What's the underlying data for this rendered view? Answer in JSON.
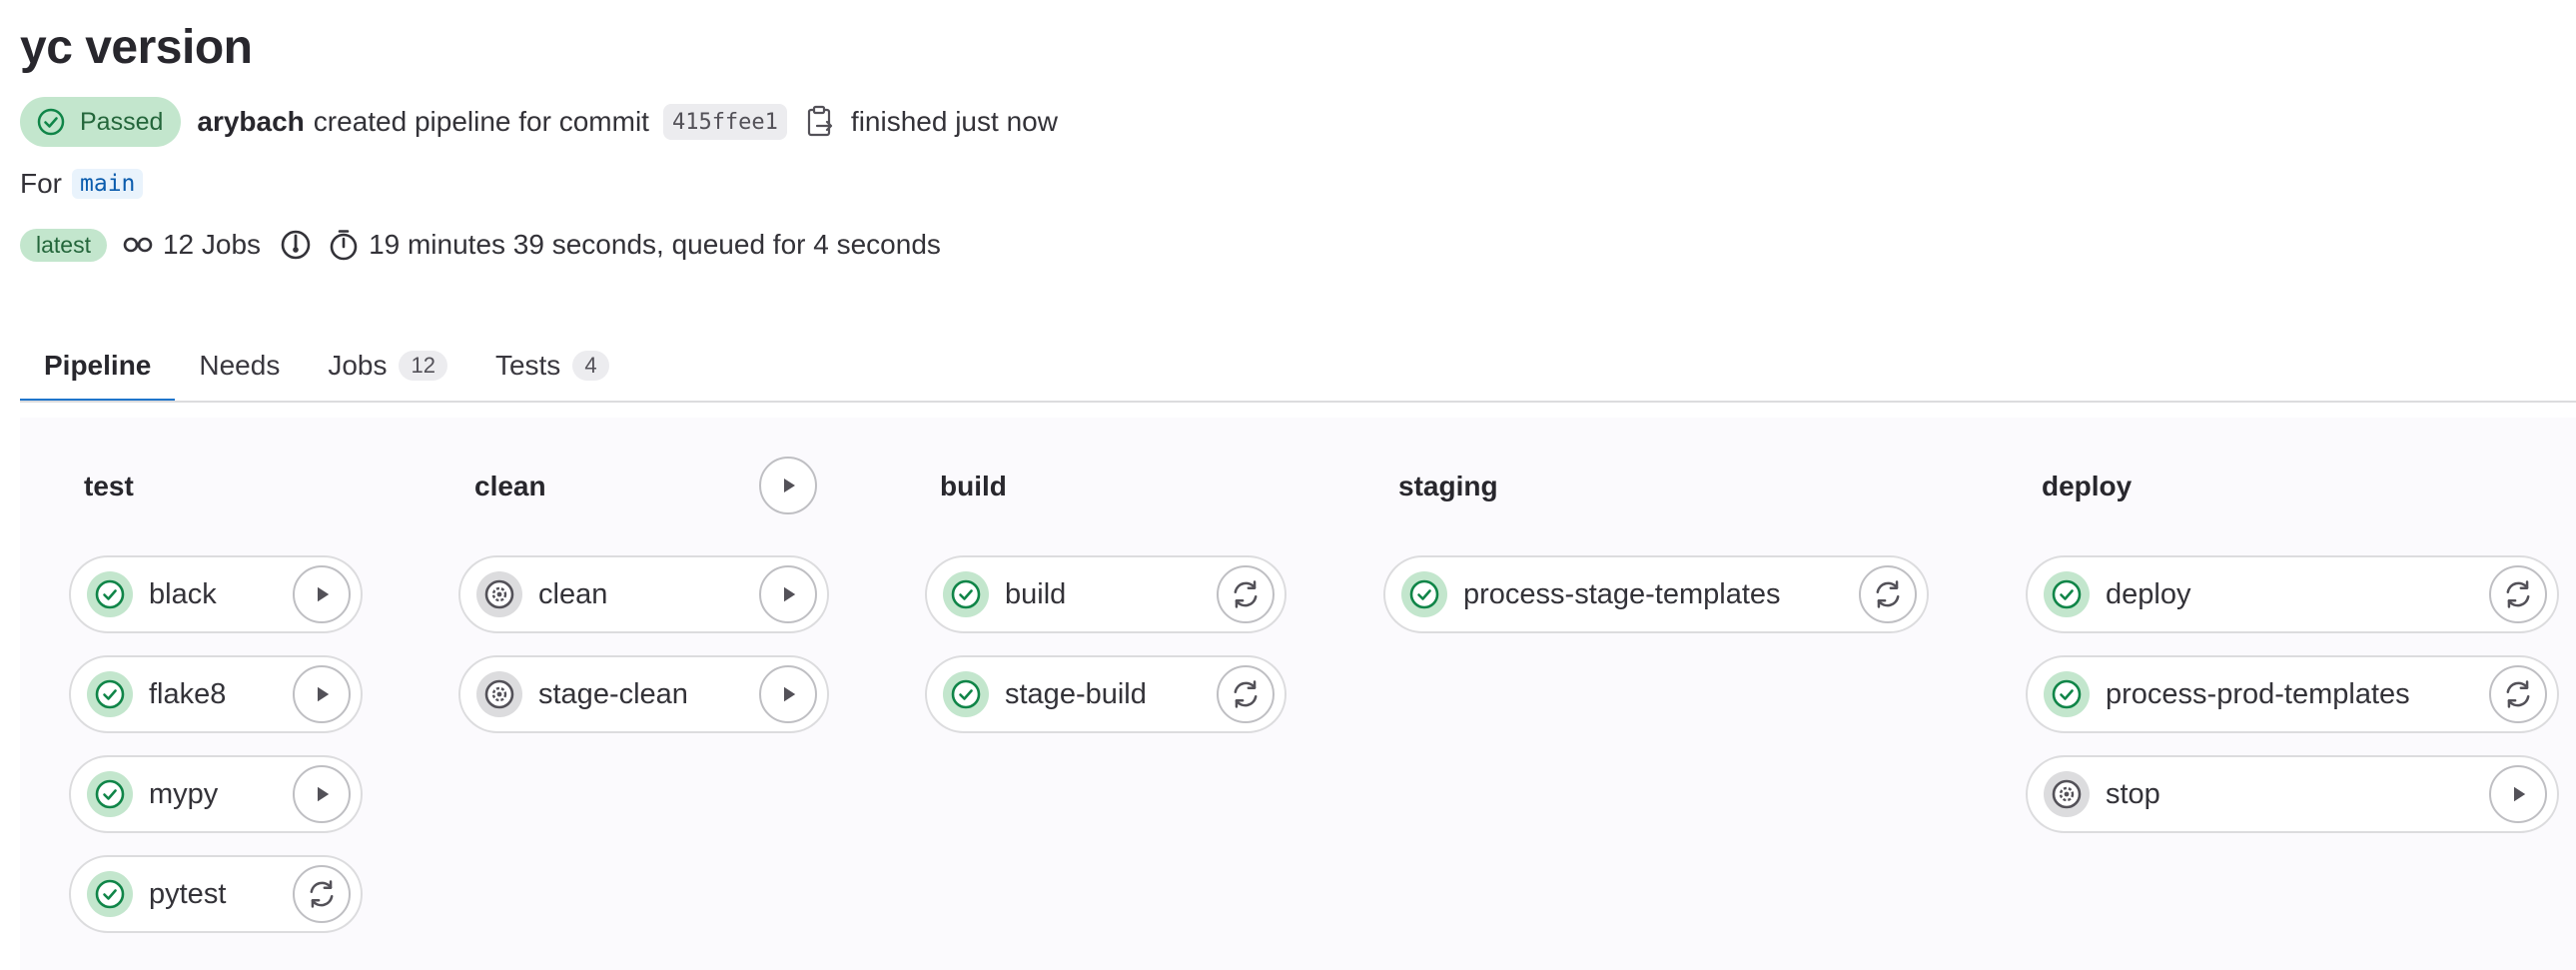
{
  "page": {
    "title": "yc version",
    "status_label": "Passed",
    "author": "arybach",
    "created_text": "created pipeline for commit",
    "commit_sha": "415ffee1",
    "finished_text": "finished just now",
    "for_label": "For",
    "ref": "main",
    "latest_label": "latest",
    "jobs_summary": "12 Jobs",
    "duration_text": "19 minutes 39 seconds, queued for 4 seconds"
  },
  "tabs": [
    {
      "label": "Pipeline",
      "count": null
    },
    {
      "label": "Needs",
      "count": null
    },
    {
      "label": "Jobs",
      "count": "12"
    },
    {
      "label": "Tests",
      "count": "4"
    }
  ],
  "stages": [
    {
      "name": "test",
      "jobs": [
        {
          "name": "black",
          "status": "passed",
          "action": "play"
        },
        {
          "name": "flake8",
          "status": "passed",
          "action": "play"
        },
        {
          "name": "mypy",
          "status": "passed",
          "action": "play"
        },
        {
          "name": "pytest",
          "status": "passed",
          "action": "retry"
        }
      ]
    },
    {
      "name": "clean",
      "jobs": [
        {
          "name": "clean",
          "status": "manual",
          "action": "play"
        },
        {
          "name": "stage-clean",
          "status": "manual",
          "action": "play"
        }
      ]
    },
    {
      "name": "build",
      "jobs": [
        {
          "name": "build",
          "status": "passed",
          "action": "retry"
        },
        {
          "name": "stage-build",
          "status": "passed",
          "action": "retry"
        }
      ]
    },
    {
      "name": "staging",
      "jobs": [
        {
          "name": "process-stage-templates",
          "status": "passed",
          "action": "retry"
        }
      ]
    },
    {
      "name": "deploy",
      "jobs": [
        {
          "name": "deploy",
          "status": "passed",
          "action": "retry"
        },
        {
          "name": "process-prod-templates",
          "status": "passed",
          "action": "retry"
        },
        {
          "name": "stop",
          "status": "manual",
          "action": "play"
        }
      ]
    }
  ],
  "colors": {
    "success": "#108548",
    "success_bg": "#c3e6cd",
    "accent": "#1f75cb",
    "manual": "#535158"
  }
}
